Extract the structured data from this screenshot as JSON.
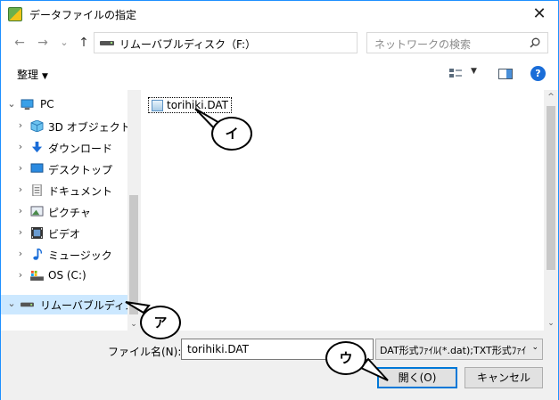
{
  "window": {
    "title": "データファイルの指定",
    "close_glyph": "✕"
  },
  "nav": {
    "back_glyph": "←",
    "forward_glyph": "→",
    "recent_glyph": "⌄",
    "up_glyph": "↑",
    "address": "リムーバブルディスク（F:）",
    "address_dropdown": "⌄",
    "refresh_glyph": "↻",
    "search_placeholder": "ネットワークの検索"
  },
  "toolbar": {
    "organize_label": "整理",
    "organize_arrow": "▼",
    "view_dropdown": "▼",
    "help_glyph": "?"
  },
  "tree": {
    "items": [
      {
        "label": "PC",
        "chevron": "⌄",
        "icon": "pc-icon"
      },
      {
        "label": "3D オブジェクト",
        "chevron": "›",
        "icon": "3d-objects-icon"
      },
      {
        "label": "ダウンロード",
        "chevron": "›",
        "icon": "download-icon"
      },
      {
        "label": "デスクトップ",
        "chevron": "›",
        "icon": "desktop-icon"
      },
      {
        "label": "ドキュメント",
        "chevron": "›",
        "icon": "documents-icon"
      },
      {
        "label": "ピクチャ",
        "chevron": "›",
        "icon": "pictures-icon"
      },
      {
        "label": "ビデオ",
        "chevron": "›",
        "icon": "video-icon"
      },
      {
        "label": "ミュージック",
        "chevron": "›",
        "icon": "music-icon"
      },
      {
        "label": "OS (C:)",
        "chevron": "›",
        "icon": "drive-c-icon"
      },
      {
        "label": "リムーバブルディスク",
        "chevron": "⌄",
        "icon": "removable-disk-icon"
      }
    ],
    "scroll_down": "⌄"
  },
  "content": {
    "file_name": "torihiki.DAT",
    "scroll_up": "^",
    "scroll_down": "⌄"
  },
  "bottom": {
    "filename_label": "ファイル名(N):",
    "filename_value": "torihiki.DAT",
    "filetype": "DAT形式ﾌｧｲﾙ(*.dat);TXT形式ﾌｧｲ",
    "filetype_dropdown": "⌄",
    "open_label": "開く(O)",
    "cancel_label": "キャンセル"
  },
  "callouts": {
    "a": "ア",
    "i": "イ",
    "u": "ウ"
  },
  "colors": {
    "selected_bg": "#cce8ff",
    "accent_blue": "#0078d7",
    "help_blue": "#1a6dd8",
    "window_border": "#1e90ff"
  }
}
